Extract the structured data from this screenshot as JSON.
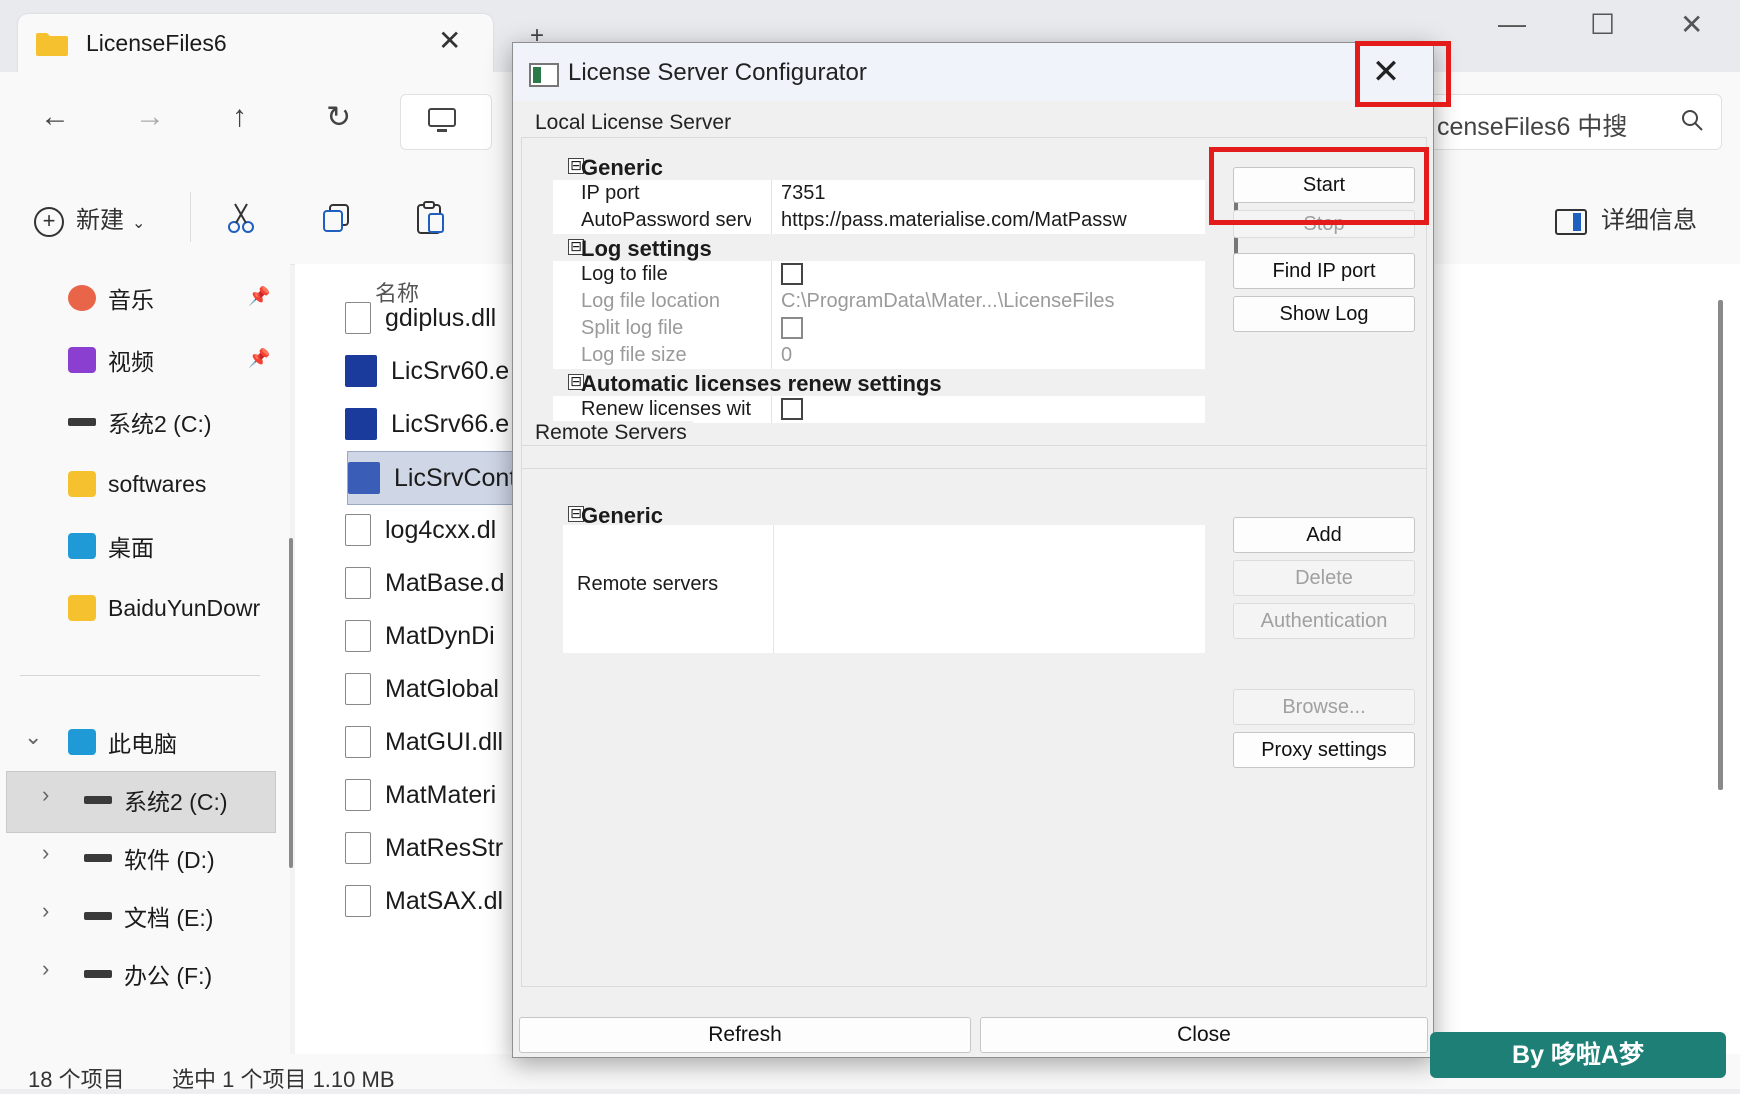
{
  "explorer": {
    "tab_title": "LicenseFiles6",
    "tab_close": "✕",
    "tab_new": "+",
    "win_min": "—",
    "win_max": "☐",
    "win_close": "✕",
    "nav": {
      "back": "←",
      "forward": "→",
      "up": "↑",
      "refresh": "↻",
      "chevron": "›"
    },
    "search_text": "censeFiles6 中搜",
    "toolbar": {
      "new_label": "新建",
      "details_label": "详细信息"
    },
    "column_name": "名称",
    "sidebar": {
      "quick": [
        {
          "label": "音乐",
          "pinned": true
        },
        {
          "label": "视频",
          "pinned": true
        },
        {
          "label": "系统2 (C:)"
        },
        {
          "label": "softwares"
        },
        {
          "label": "桌面"
        },
        {
          "label": "BaiduYunDowr"
        }
      ],
      "this_pc": "此电脑",
      "drives": [
        {
          "label": "系统2 (C:)"
        },
        {
          "label": "软件 (D:)"
        },
        {
          "label": "文档 (E:)"
        },
        {
          "label": "办公 (F:)"
        }
      ]
    },
    "files": [
      "gdiplus.dll",
      "LicSrv60.e",
      "LicSrv66.e",
      "LicSrvCont",
      "log4cxx.dl",
      "MatBase.d",
      "MatDynDi",
      "MatGlobal",
      "MatGUI.dll",
      "MatMateri",
      "MatResStr",
      "MatSAX.dl"
    ],
    "status": {
      "count": "18 个项目",
      "selected": "选中 1 个项目  1.10 MB"
    }
  },
  "dialog": {
    "title": "License Server Configurator",
    "close_glyph": "✕",
    "local_group": "Local License Server",
    "remote_group": "Remote Servers",
    "local_props": [
      {
        "type": "category",
        "label": "Generic"
      },
      {
        "key": "IP port",
        "value": "7351"
      },
      {
        "key": "AutoPassword server ...",
        "value": "https://pass.materialise.com/MatPassw"
      },
      {
        "type": "category",
        "label": "Log settings"
      },
      {
        "key": "Log to file",
        "value": ""
      },
      {
        "key": "Log file location",
        "value": "C:\\ProgramData\\Mater...\\LicenseFiles"
      },
      {
        "key": "Split log file",
        "value": ""
      },
      {
        "key": "Log file size",
        "value": "0"
      },
      {
        "type": "category",
        "label": "Automatic licenses renew settings"
      },
      {
        "key": "Renew licenses with C...",
        "value": ""
      }
    ],
    "collapse_glyph": "⊟",
    "buttons": {
      "start": "Start",
      "stop": "Stop",
      "find_ip_port": "Find IP port",
      "show_log": "Show Log",
      "add": "Add",
      "delete": "Delete",
      "authentication": "Authentication",
      "browse": "Browse...",
      "proxy_settings": "Proxy settings",
      "refresh": "Refresh",
      "close": "Close"
    },
    "remote_category": "Generic",
    "remote_servers_label": "Remote servers"
  },
  "watermark": "By 哆啦A梦",
  "colors": {
    "highlight": "#e31b1b",
    "watermark_bg": "#1d7f76",
    "selection": "#cfd6e6"
  }
}
